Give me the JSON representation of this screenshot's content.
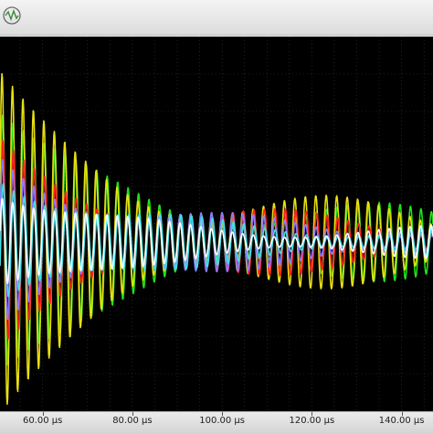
{
  "window": {
    "title_icon": "oscilloscope-icon"
  },
  "colors": {
    "background": "#000000",
    "grid": "#3a3a3a",
    "channels": [
      "#22e01a",
      "#e8e010",
      "#ff2020",
      "#8a7cff",
      "#40e0e8",
      "#ffffff"
    ]
  },
  "chart_data": {
    "type": "line",
    "title": "",
    "xlabel": "",
    "ylabel": "",
    "x_unit": "µs",
    "xlim": [
      50.5,
      147
    ],
    "ylim": [
      -1.0,
      1.0
    ],
    "grid": true,
    "tick_labels": [
      "60.00 µs",
      "80.00 µs",
      "100.00 µs",
      "120.00 µs",
      "140.00 µs"
    ],
    "tick_values": [
      60,
      80,
      100,
      120,
      140
    ],
    "series": [
      {
        "color": "#22e01a",
        "frequency_mhz": 0.195,
        "amplitude": 0.78,
        "decay_to": 0.28,
        "phase": 0.0
      },
      {
        "color": "#e8e010",
        "frequency_mhz": 0.195,
        "amplitude": 0.95,
        "decay_to": 0.32,
        "phase": 0.35
      },
      {
        "color": "#ff2020",
        "frequency_mhz": 0.195,
        "amplitude": 0.55,
        "decay_to": 0.22,
        "phase": -0.2
      },
      {
        "color": "#8a7cff",
        "frequency_mhz": 0.195,
        "amplitude": 0.5,
        "decay_to": 0.18,
        "phase": 0.15
      },
      {
        "color": "#40e0e8",
        "frequency_mhz": 0.195,
        "amplitude": 0.4,
        "decay_to": 0.15,
        "phase": -0.4
      },
      {
        "color": "#ffffff",
        "frequency_mhz": 0.195,
        "amplitude": 0.3,
        "decay_to": 0.12,
        "phase": 0.25
      }
    ]
  }
}
